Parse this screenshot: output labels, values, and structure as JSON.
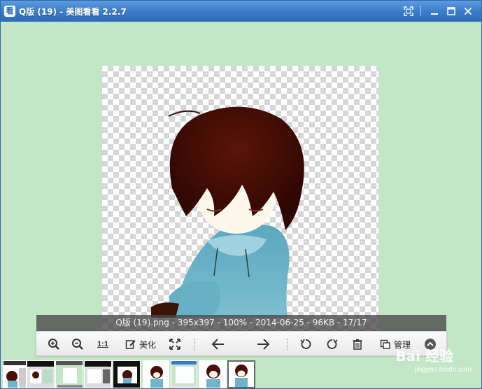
{
  "window": {
    "title": "Q版 (19) - 美图看看 2.2.7",
    "app_icon_char": "看"
  },
  "image": {
    "name": "Q版 (19).png",
    "info": "Q版 (19).png - 395x397 - 100% - 2014-06-25 - 96KB - 17/17"
  },
  "toolbar": {
    "zoom_in": "zoom-in-icon",
    "zoom_out": "zoom-out-icon",
    "actual_size_label": "1:1",
    "beautify_label": "美化",
    "fit_screen": "fullscreen-icon",
    "prev": "arrow-left-icon",
    "next": "arrow-right-icon",
    "rotate_left": "rotate-left-icon",
    "rotate_right": "rotate-right-icon",
    "delete": "trash-icon",
    "manage_label": "管理",
    "collapse": "chevron-up-icon"
  },
  "thumbnails": {
    "count": 9,
    "active_index": 8
  },
  "watermark": {
    "text": "Bai 经验",
    "sub": "jingyan.baidu.com"
  },
  "colors": {
    "titlebar": "#3a7bc9",
    "background": "#c3e6c6",
    "info_bar": "#464646",
    "toolbar": "#f2f2f2",
    "hair": "#4a0e06",
    "hoodie": "#6fb5c8"
  }
}
